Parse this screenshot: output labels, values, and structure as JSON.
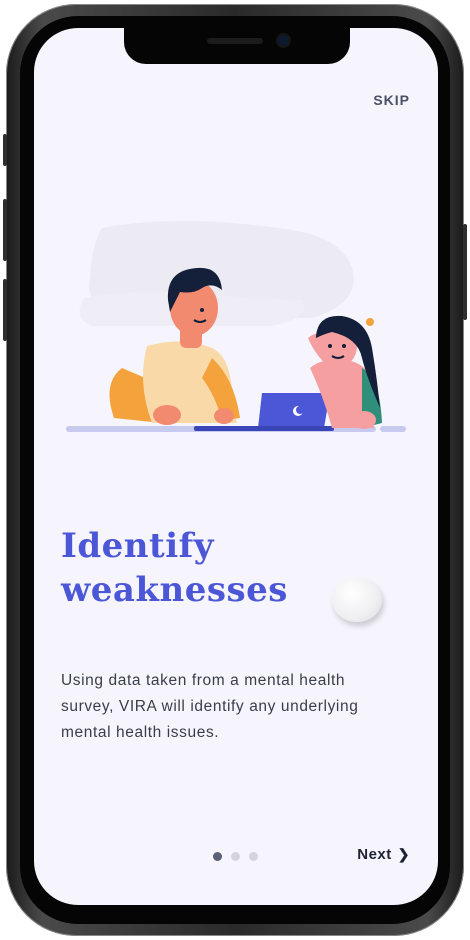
{
  "onboarding": {
    "skip_label": "SKIP",
    "title_line1": "Identify",
    "title_line2": "weaknesses",
    "description": "Using data taken from a mental health survey, VIRA will identify any underlying mental health issues.",
    "next_label": "Next",
    "next_icon": "chevron-right-icon",
    "pagination": {
      "total": 3,
      "current": 1
    }
  },
  "colors": {
    "accent": "#4b57d6",
    "background": "#f6f5fd",
    "dot_active": "#5a5f73",
    "dot_inactive": "#d3d4dc"
  }
}
